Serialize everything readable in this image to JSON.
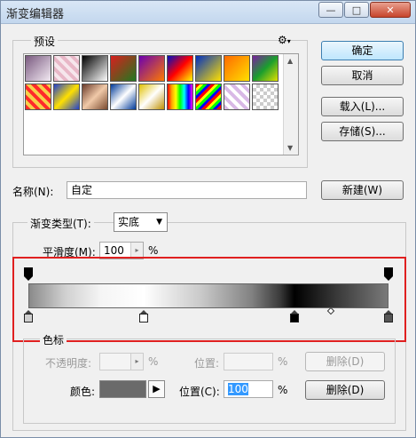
{
  "window": {
    "title": "渐变编辑器",
    "min_glyph": "—",
    "max_glyph": "□",
    "close_glyph": "✕"
  },
  "presets": {
    "label": "预设",
    "swatches": [
      "linear-gradient(135deg,#7a5a80,#f3eaf3)",
      "repeating-linear-gradient(45deg,#e8b7c7 0 4px,#f6e6ec 4px 8px)",
      "linear-gradient(135deg,#000,#fff)",
      "linear-gradient(135deg,#d91e1e,#1f7a1f)",
      "linear-gradient(135deg,#6a00b0,#ff7a00)",
      "linear-gradient(135deg,#0010c0,#ff0000,#ffff00)",
      "linear-gradient(135deg,#0030c0,#ffe000)",
      "linear-gradient(135deg,#ff6a00,#ffe000)",
      "linear-gradient(135deg,#7a1fa0,#1a9e2e,#e0e000)",
      "repeating-linear-gradient(45deg,#ff2a2a 0 4px,#f6d04a 4px 8px)",
      "linear-gradient(135deg,#2040d0,#ffe000,#2040d0)",
      "linear-gradient(135deg,#6a3a2a,#f0c9a8,#7a4a30)",
      "linear-gradient(135deg,#003a9a,#ffffff,#003a9a)",
      "linear-gradient(135deg,#e0c000,#fff,#c09000)",
      "linear-gradient(90deg,red,orange,yellow,lime,cyan,blue,magenta)",
      "repeating-linear-gradient(135deg,red 0 3px,yellow 3px 6px,lime 6px 9px,blue 9px 12px)",
      "repeating-linear-gradient(45deg,#d9b9e6 0 4px,#fff 4px 8px)",
      "repeating-conic-gradient(#ccc 0 25%,#fff 0 50%)"
    ]
  },
  "buttons": {
    "ok": "确定",
    "cancel": "取消",
    "load": "载入(L)...",
    "save": "存储(S)...",
    "new": "新建(W)"
  },
  "name": {
    "label": "名称(N):",
    "value": "自定"
  },
  "gradient": {
    "type_label": "渐变类型(T):",
    "type_value": "实底",
    "smooth_label": "平滑度(M):",
    "smooth_value": "100",
    "smooth_unit": "%"
  },
  "opacity_stops_percent": [
    0,
    100
  ],
  "color_stops": [
    {
      "position_percent": 0,
      "color": "#cfcfcf"
    },
    {
      "position_percent": 32,
      "color": "#ffffff"
    },
    {
      "position_percent": 74,
      "color": "#000000"
    },
    {
      "position_percent": 100,
      "color": "#555555"
    }
  ],
  "midpoint_percent": 84,
  "stops": {
    "group_label": "色标",
    "opacity_label": "不透明度:",
    "opacity_unit": "%",
    "opacity_pos_label": "位置:",
    "opacity_pos_unit": "%",
    "opacity_delete": "删除(D)",
    "color_label": "颜色:",
    "color_value": "#6a6a6a",
    "color_pos_label": "位置(C):",
    "color_pos_value": "100",
    "color_pos_unit": "%",
    "color_delete": "删除(D)"
  }
}
